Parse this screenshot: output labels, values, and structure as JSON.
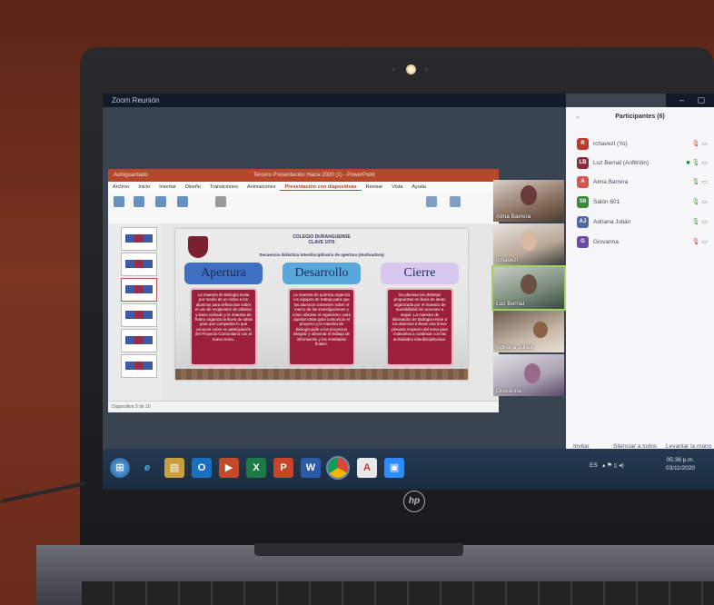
{
  "zoom": {
    "window_title": "Zoom Reunión",
    "window_controls": "– ▢ ✕"
  },
  "powerpoint": {
    "title_left": "Autoguardado",
    "title_center": "Tercero Presentación Hacia 2020 (1) - PowerPoint",
    "tabs": [
      "Archivo",
      "Inicio",
      "Insertar",
      "Diseño",
      "Transiciones",
      "Animaciones",
      "Presentación con diapositivas",
      "Revisar",
      "Vista",
      "Ayuda"
    ],
    "active_tab": "Presentación con diapositivas",
    "status": "Diapositiva 3 de 10"
  },
  "slide": {
    "school": "COLEGIO DURANGUENSE",
    "clave": "CLAVE 1076",
    "subtitle": "Secuencia didáctica interdisciplinaria de apertura (motivadora)",
    "columns": [
      {
        "title": "Apertura",
        "text": "La maestra de Biología invita por medio de un video a los alumnos para reflexionar sobre el uso de recipientes de plástico y barro vidriado y la maestra de Teatro organiza la lluvia de ideas para que compartan lo que conocen sobre su participación del Proyecto Comunitario con el nuevo tema."
      },
      {
        "title": "Desarrollo",
        "text": "La maestra de química organiza los equipos de trabajo para que los alumnos comenten sobre el marco de las investigaciones y cómo afectan el organismo; para aportar ideas para comunicar el proyecto y la maestra de Biología pide a los proyectos integrar y observar el trabajo de información y los resultados finales."
      },
      {
        "title": "Cierre",
        "text": "Se planean las distintas propuestas en lluvia de ideas organizada por el maestro de Sociabilidad los acciones a seguir. La maestra de laboratorio de Biología reúne a los alumnos a llevar una breve plenaria respecto del tema para motivarlos a continuar con las actividades interdisciplinarias."
      }
    ]
  },
  "videos": [
    {
      "name": "Alma Barrera",
      "active": false
    },
    {
      "name": "rchavezl",
      "active": false
    },
    {
      "name": "Luz Bernal",
      "active": true
    },
    {
      "name": "Adriana Julián",
      "active": false
    },
    {
      "name": "Giovanna",
      "active": false
    }
  ],
  "participants": {
    "title": "Participantes (6)",
    "list": [
      {
        "initials": "R",
        "name": "rchavezl (Yo)",
        "color": "#c0392b",
        "mic": "muted"
      },
      {
        "initials": "LB",
        "name": "Luz Bernal (Anfitrión)",
        "color": "#8e2a3a",
        "mic": "on"
      },
      {
        "initials": "A",
        "name": "Alma Barrera",
        "color": "#d9534f",
        "mic": "muted"
      },
      {
        "initials": "S6",
        "name": "Salón 601",
        "color": "#3a8a3a",
        "mic": "muted"
      },
      {
        "initials": "AJ",
        "name": "Adriana Julián",
        "color": "#4a6aa8",
        "mic": "muted"
      },
      {
        "initials": "G",
        "name": "Giovanna",
        "color": "#6a4aa8",
        "mic": "muted"
      }
    ],
    "footer": [
      "Invitar",
      "Silenciar a todos",
      "Levantar la mano"
    ]
  },
  "taskbar": {
    "apps": [
      "start",
      "edge",
      "explorer",
      "outlook",
      "powerpoint-alt",
      "excel",
      "powerpoint",
      "word",
      "chrome",
      "acrobat",
      "zoom"
    ],
    "lang": "ES",
    "time": "05:36 p.m.",
    "date": "03/11/2020"
  },
  "brand": "hp"
}
